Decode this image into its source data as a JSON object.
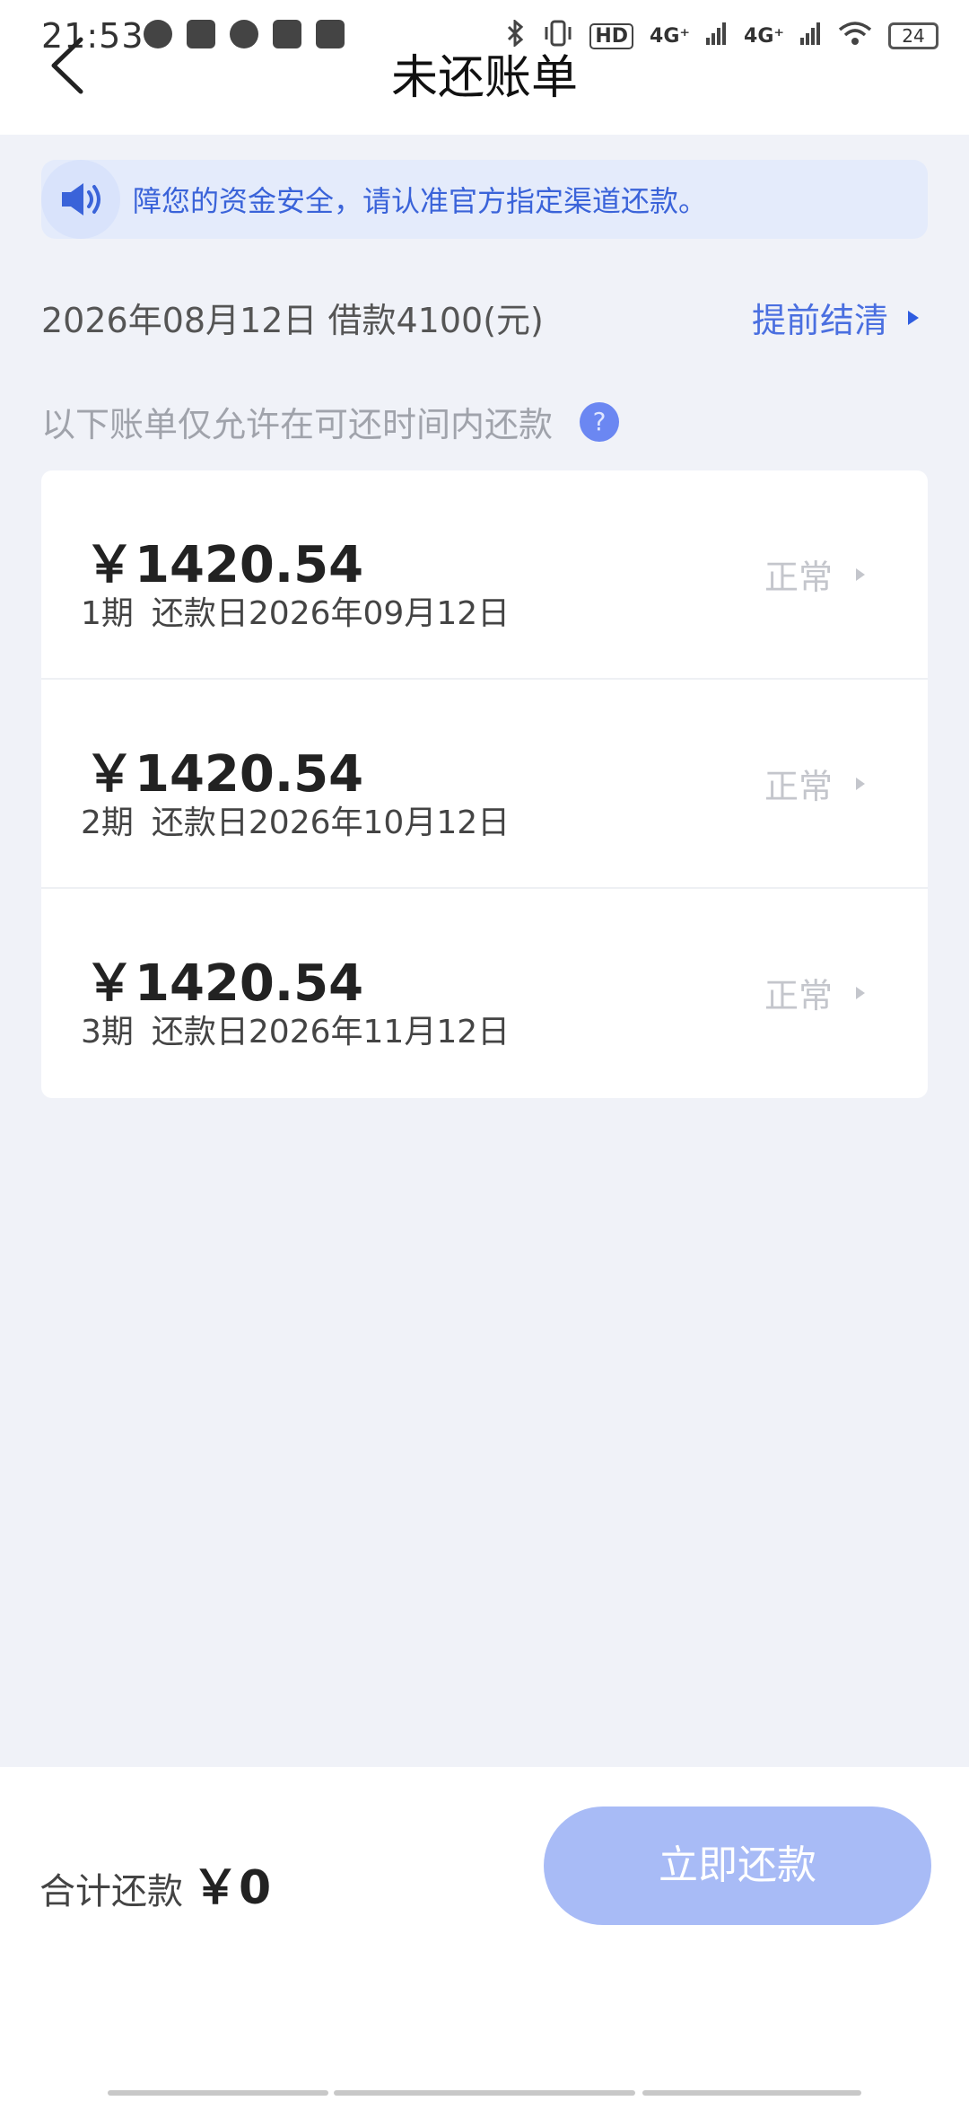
{
  "status_bar": {
    "time": "21:53",
    "battery": "24",
    "signal_labels": [
      "4G⁺",
      "4G⁺"
    ],
    "hd_label": "HD"
  },
  "header": {
    "title": "未还账单"
  },
  "notice": {
    "text": "障您的资金安全，请认准官方指定渠道还款。"
  },
  "loan": {
    "summary": "2026年08月12日 借款4100(元)",
    "settle_label": "提前结清"
  },
  "hint": {
    "text": "以下账单仅允许在可还时间内还款",
    "help_symbol": "?"
  },
  "bills": [
    {
      "amount": "￥1420.54",
      "period": "1期",
      "due": "还款日2026年09月12日",
      "status": "正常"
    },
    {
      "amount": "￥1420.54",
      "period": "2期",
      "due": "还款日2026年10月12日",
      "status": "正常"
    },
    {
      "amount": "￥1420.54",
      "period": "3期",
      "due": "还款日2026年11月12日",
      "status": "正常"
    }
  ],
  "footer": {
    "total_label": "合计还款",
    "total_amount": "￥0",
    "pay_button": "立即还款"
  },
  "colors": {
    "accent": "#4a6fe0",
    "button_disabled": "#a8bbf6",
    "notice_bg": "#e4ebfb",
    "page_bg": "#f0f2f8"
  }
}
